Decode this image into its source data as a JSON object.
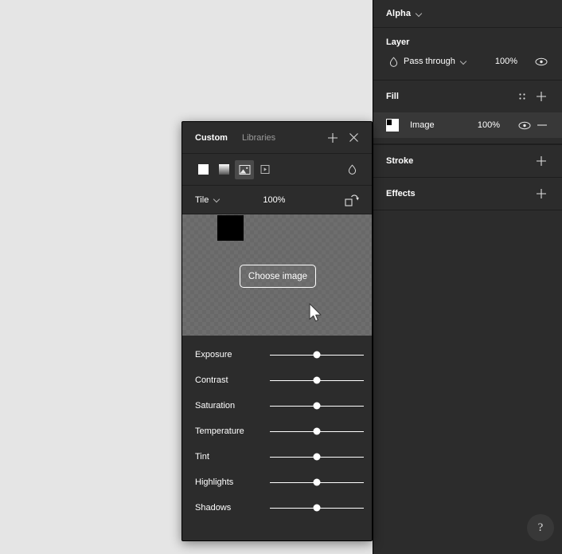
{
  "canvas": {
    "background_color": "#e5e5e5"
  },
  "right_panel": {
    "background_color": "#2c2c2c",
    "alpha": {
      "label": "Alpha",
      "chevron_icon": "chevron-down-icon"
    },
    "layer": {
      "title": "Layer",
      "blend_mode_icon": "droplet-icon",
      "blend_mode": "Pass through",
      "chevron_icon": "chevron-down-icon",
      "opacity": "100%",
      "visibility_icon": "eye-icon"
    },
    "fill": {
      "title": "Fill",
      "settings_icon": "fill-style-icon",
      "add_icon": "plus-icon",
      "items": [
        {
          "swatch_icon": "image-swatch",
          "name": "Image",
          "opacity": "100%",
          "visibility_icon": "eye-icon",
          "remove_icon": "minus-icon",
          "selected": true
        }
      ]
    },
    "stroke": {
      "title": "Stroke",
      "add_icon": "plus-icon"
    },
    "effects": {
      "title": "Effects",
      "add_icon": "plus-icon"
    },
    "help_button": {
      "label": "?",
      "name": "help-button"
    }
  },
  "dialog": {
    "tabs": [
      {
        "label": "Custom",
        "active": true
      },
      {
        "label": "Libraries",
        "active": false
      }
    ],
    "add_icon": "plus-icon",
    "close_icon": "close-icon",
    "fill_types": [
      {
        "name": "solid-fill-type",
        "icon": "solid-square-icon",
        "selected": false
      },
      {
        "name": "gradient-fill-type",
        "icon": "gradient-square-icon",
        "selected": false
      },
      {
        "name": "image-fill-type",
        "icon": "image-icon",
        "selected": true
      },
      {
        "name": "video-fill-type",
        "icon": "video-icon",
        "selected": false
      }
    ],
    "opacity_icon": "droplet-icon",
    "scale_mode": {
      "label": "Tile",
      "chevron_icon": "chevron-down-icon",
      "value": "100%",
      "rotate_icon": "rotate-icon"
    },
    "preview": {
      "choose_image_label": "Choose image",
      "checker_color_light": "#6e6e6e",
      "checker_color_dark": "#686868",
      "thumbnail_color": "#000000",
      "cursor_icon": "arrow-cursor"
    },
    "adjustments": [
      {
        "label": "Exposure",
        "value": 50
      },
      {
        "label": "Contrast",
        "value": 50
      },
      {
        "label": "Saturation",
        "value": 50
      },
      {
        "label": "Temperature",
        "value": 50
      },
      {
        "label": "Tint",
        "value": 50
      },
      {
        "label": "Highlights",
        "value": 50
      },
      {
        "label": "Shadows",
        "value": 50
      }
    ]
  }
}
